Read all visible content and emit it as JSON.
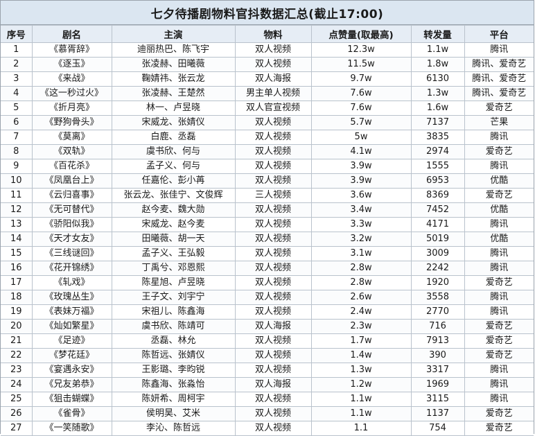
{
  "title": "七夕待播剧物料官抖数据汇总(截止17:00)",
  "columns": [
    "序号",
    "剧名",
    "主演",
    "物料",
    "点赞量(取最高)",
    "转发量",
    "平台"
  ],
  "rows": [
    [
      "1",
      "《慕胥辞》",
      "迪丽热巴、陈飞宇",
      "双人视频",
      "12.3w",
      "1.1w",
      "腾讯"
    ],
    [
      "2",
      "《逐玉》",
      "张凌赫、田曦薇",
      "双人视频",
      "11.5w",
      "1.8w",
      "腾讯、爱奇艺"
    ],
    [
      "3",
      "《来战》",
      "鞠婧祎、张云龙",
      "双人海报",
      "9.7w",
      "6130",
      "腾讯、爱奇艺"
    ],
    [
      "4",
      "《这一秒过火》",
      "张凌赫、王楚然",
      "男主单人视频",
      "7.6w",
      "1.3w",
      "腾讯、爱奇艺"
    ],
    [
      "5",
      "《折月亮》",
      "林一、卢昱晓",
      "双人官宣视频",
      "7.6w",
      "1.6w",
      "爱奇艺"
    ],
    [
      "6",
      "《野狗骨头》",
      "宋威龙、张婧仪",
      "双人视频",
      "5.7w",
      "7137",
      "芒果"
    ],
    [
      "7",
      "《莫离》",
      "白鹿、丞磊",
      "双人视频",
      "5w",
      "3835",
      "腾讯"
    ],
    [
      "8",
      "《双轨》",
      "虞书欣、何与",
      "双人视频",
      "4.1w",
      "2974",
      "爱奇艺"
    ],
    [
      "9",
      "《百花杀》",
      "孟子义、何与",
      "双人视频",
      "3.9w",
      "1555",
      "腾讯"
    ],
    [
      "10",
      "《凤凰台上》",
      "任嘉伦、彭小苒",
      "双人视频",
      "3.9w",
      "6953",
      "优酷"
    ],
    [
      "11",
      "《云归喜事》",
      "张云龙、张佳宁、文俊辉",
      "三人视频",
      "3.6w",
      "8369",
      "爱奇艺"
    ],
    [
      "12",
      "《无可替代》",
      "赵今麦、魏大勋",
      "双人视频",
      "3.4w",
      "7452",
      "优酷"
    ],
    [
      "13",
      "《骄阳似我》",
      "宋威龙、赵今麦",
      "双人视频",
      "3.3w",
      "4171",
      "腾讯"
    ],
    [
      "14",
      "《天才女友》",
      "田曦薇、胡一天",
      "双人视频",
      "3.2w",
      "5019",
      "优酷"
    ],
    [
      "15",
      "《三线谜回》",
      "孟子义、王弘毅",
      "双人视频",
      "3.1w",
      "3009",
      "腾讯"
    ],
    [
      "16",
      "《花开锦绣》",
      "丁禹兮、邓恩熙",
      "双人视频",
      "2.8w",
      "2242",
      "腾讯"
    ],
    [
      "17",
      "《轧戏》",
      "陈星旭、卢昱晓",
      "双人视频",
      "2.8w",
      "1920",
      "爱奇艺"
    ],
    [
      "18",
      "《玫瑰丛生》",
      "王子文、刘宇宁",
      "双人视频",
      "2.6w",
      "3558",
      "腾讯"
    ],
    [
      "19",
      "《表妹万福》",
      "宋祖儿、陈鑫海",
      "双人视频",
      "2.4w",
      "2770",
      "腾讯"
    ],
    [
      "20",
      "《灿如繁星》",
      "虞书欣、陈靖可",
      "双人海报",
      "2.3w",
      "716",
      "爱奇艺"
    ],
    [
      "21",
      "《足迹》",
      "丞磊、林允",
      "双人视频",
      "1.7w",
      "7913",
      "爱奇艺"
    ],
    [
      "22",
      "《梦花廷》",
      "陈哲远、张婧仪",
      "双人视频",
      "1.4w",
      "390",
      "爱奇艺"
    ],
    [
      "23",
      "《宴遇永安》",
      "王影璐、李昀锐",
      "双人视频",
      "1.3w",
      "3317",
      "腾讯"
    ],
    [
      "24",
      "《兄友弟恭》",
      "陈鑫海、张淼怡",
      "双人海报",
      "1.2w",
      "1969",
      "腾讯"
    ],
    [
      "25",
      "《狙击蝴蝶》",
      "陈妍希、周柯宇",
      "双人视频",
      "1.1w",
      "3115",
      "腾讯"
    ],
    [
      "26",
      "《雀骨》",
      "侯明昊、艾米",
      "双人视频",
      "1.1w",
      "1137",
      "爱奇艺"
    ],
    [
      "27",
      "《一笑随歌》",
      "李沁、陈哲远",
      "双人视频",
      "1.1",
      "754",
      "爱奇艺"
    ]
  ]
}
